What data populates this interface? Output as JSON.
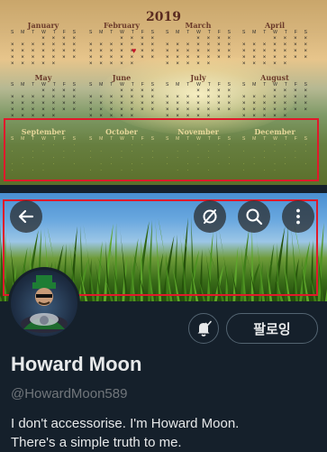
{
  "calendar": {
    "year": "2019",
    "dow": [
      "S",
      "M",
      "T",
      "W",
      "T",
      "F",
      "S"
    ],
    "months": [
      {
        "name": "January"
      },
      {
        "name": "February"
      },
      {
        "name": "March"
      },
      {
        "name": "April"
      },
      {
        "name": "May"
      },
      {
        "name": "June"
      },
      {
        "name": "July"
      },
      {
        "name": "August"
      },
      {
        "name": "September"
      },
      {
        "name": "October"
      },
      {
        "name": "November"
      },
      {
        "name": "December"
      }
    ]
  },
  "header_buttons": {
    "back": "back-arrow-icon",
    "hide": "slashed-circle-icon",
    "search": "search-icon",
    "more": "more-vertical-icon"
  },
  "profile": {
    "follow_label": "팔로잉",
    "display_name": "Howard Moon",
    "handle": "@HowardMoon589",
    "bio_line1": "I don't accessorise. I'm Howard Moon.",
    "bio_line2": "There's a simple truth to me."
  },
  "colors": {
    "background": "#15202b",
    "highlight_box": "#e0192b",
    "text_primary": "#e7e9ea",
    "text_secondary": "#71767b"
  }
}
